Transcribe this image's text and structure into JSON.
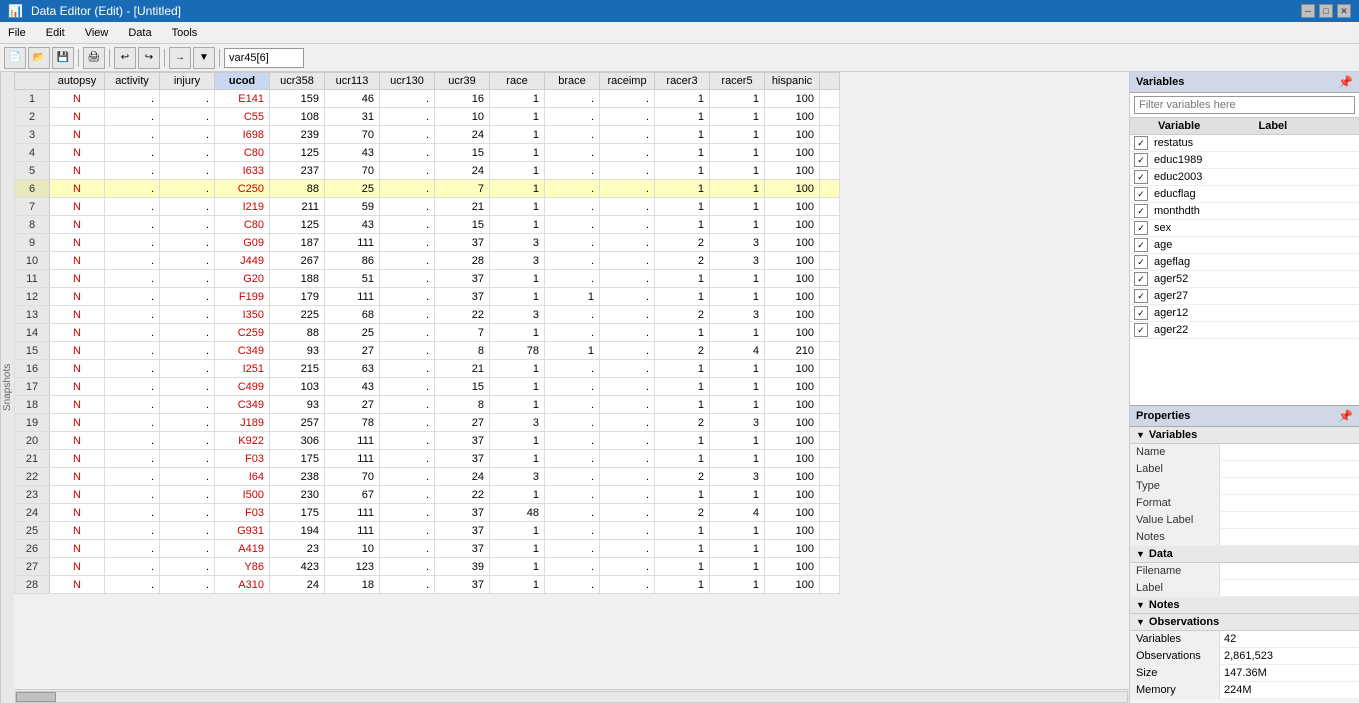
{
  "titlebar": {
    "title": "Data Editor (Edit) - [Untitled]",
    "controls": [
      "minimize",
      "maximize",
      "close"
    ]
  },
  "menu": {
    "items": [
      "File",
      "Edit",
      "View",
      "Data",
      "Tools"
    ]
  },
  "toolbar": {
    "cell_ref": "var45[6]"
  },
  "columns": [
    {
      "id": "rownum",
      "label": ""
    },
    {
      "id": "autopsy",
      "label": "autopsy"
    },
    {
      "id": "activity",
      "label": "activity"
    },
    {
      "id": "injury",
      "label": "injury"
    },
    {
      "id": "ucod",
      "label": "ucod",
      "highlighted": true
    },
    {
      "id": "ucr358",
      "label": "ucr358"
    },
    {
      "id": "ucr113",
      "label": "ucr113"
    },
    {
      "id": "ucr130",
      "label": "ucr130"
    },
    {
      "id": "ucr39",
      "label": "ucr39"
    },
    {
      "id": "race",
      "label": "race"
    },
    {
      "id": "brace",
      "label": "brace"
    },
    {
      "id": "raceimp",
      "label": "raceimp"
    },
    {
      "id": "racer3",
      "label": "racer3"
    },
    {
      "id": "racer5",
      "label": "racer5"
    },
    {
      "id": "hispanic",
      "label": "hispanic"
    }
  ],
  "rows": [
    {
      "rownum": 1,
      "autopsy": "N",
      "activity": ".",
      "injury": ".",
      "ucod": "E141",
      "ucr358": 159,
      "ucr113": 46,
      "ucr130": ".",
      "ucr39": 16,
      "race": 1,
      "brace": ".",
      "raceimp": ".",
      "racer3": 1,
      "racer5": 1,
      "hispanic": 100
    },
    {
      "rownum": 2,
      "autopsy": "N",
      "activity": ".",
      "injury": ".",
      "ucod": "C55",
      "ucr358": 108,
      "ucr113": 31,
      "ucr130": ".",
      "ucr39": 10,
      "race": 1,
      "brace": ".",
      "raceimp": ".",
      "racer3": 1,
      "racer5": 1,
      "hispanic": 100
    },
    {
      "rownum": 3,
      "autopsy": "N",
      "activity": ".",
      "injury": ".",
      "ucod": "I698",
      "ucr358": 239,
      "ucr113": 70,
      "ucr130": ".",
      "ucr39": 24,
      "race": 1,
      "brace": ".",
      "raceimp": ".",
      "racer3": 1,
      "racer5": 1,
      "hispanic": 100
    },
    {
      "rownum": 4,
      "autopsy": "N",
      "activity": ".",
      "injury": ".",
      "ucod": "C80",
      "ucr358": 125,
      "ucr113": 43,
      "ucr130": ".",
      "ucr39": 15,
      "race": 1,
      "brace": ".",
      "raceimp": ".",
      "racer3": 1,
      "racer5": 1,
      "hispanic": 100
    },
    {
      "rownum": 5,
      "autopsy": "N",
      "activity": ".",
      "injury": ".",
      "ucod": "I633",
      "ucr358": 237,
      "ucr113": 70,
      "ucr130": ".",
      "ucr39": 24,
      "race": 1,
      "brace": ".",
      "raceimp": ".",
      "racer3": 1,
      "racer5": 1,
      "hispanic": 100
    },
    {
      "rownum": 6,
      "autopsy": "N",
      "activity": ".",
      "injury": ".",
      "ucod": "C250",
      "ucr358": 88,
      "ucr113": 25,
      "ucr130": ".",
      "ucr39": 7,
      "race": 1,
      "brace": ".",
      "raceimp": ".",
      "racer3": 1,
      "racer5": 1,
      "hispanic": 100,
      "selected": true
    },
    {
      "rownum": 7,
      "autopsy": "N",
      "activity": ".",
      "injury": ".",
      "ucod": "I219",
      "ucr358": 211,
      "ucr113": 59,
      "ucr130": ".",
      "ucr39": 21,
      "race": 1,
      "brace": ".",
      "raceimp": ".",
      "racer3": 1,
      "racer5": 1,
      "hispanic": 100
    },
    {
      "rownum": 8,
      "autopsy": "N",
      "activity": ".",
      "injury": ".",
      "ucod": "C80",
      "ucr358": 125,
      "ucr113": 43,
      "ucr130": ".",
      "ucr39": 15,
      "race": 1,
      "brace": ".",
      "raceimp": ".",
      "racer3": 1,
      "racer5": 1,
      "hispanic": 100
    },
    {
      "rownum": 9,
      "autopsy": "N",
      "activity": ".",
      "injury": ".",
      "ucod": "G09",
      "ucr358": 187,
      "ucr113": 111,
      "ucr130": ".",
      "ucr39": 37,
      "race": 3,
      "brace": ".",
      "raceimp": ".",
      "racer3": 2,
      "racer5": 3,
      "hispanic": 100
    },
    {
      "rownum": 10,
      "autopsy": "N",
      "activity": ".",
      "injury": ".",
      "ucod": "J449",
      "ucr358": 267,
      "ucr113": 86,
      "ucr130": ".",
      "ucr39": 28,
      "race": 3,
      "brace": ".",
      "raceimp": ".",
      "racer3": 2,
      "racer5": 3,
      "hispanic": 100
    },
    {
      "rownum": 11,
      "autopsy": "N",
      "activity": ".",
      "injury": ".",
      "ucod": "G20",
      "ucr358": 188,
      "ucr113": 51,
      "ucr130": ".",
      "ucr39": 37,
      "race": 1,
      "brace": ".",
      "raceimp": ".",
      "racer3": 1,
      "racer5": 1,
      "hispanic": 100
    },
    {
      "rownum": 12,
      "autopsy": "N",
      "activity": ".",
      "injury": ".",
      "ucod": "F199",
      "ucr358": 179,
      "ucr113": 111,
      "ucr130": ".",
      "ucr39": 37,
      "race": 1,
      "brace": 1,
      "raceimp": ".",
      "racer3": 1,
      "racer5": 1,
      "hispanic": 100
    },
    {
      "rownum": 13,
      "autopsy": "N",
      "activity": ".",
      "injury": ".",
      "ucod": "I350",
      "ucr358": 225,
      "ucr113": 68,
      "ucr130": ".",
      "ucr39": 22,
      "race": 3,
      "brace": ".",
      "raceimp": ".",
      "racer3": 2,
      "racer5": 3,
      "hispanic": 100
    },
    {
      "rownum": 14,
      "autopsy": "N",
      "activity": ".",
      "injury": ".",
      "ucod": "C259",
      "ucr358": 88,
      "ucr113": 25,
      "ucr130": ".",
      "ucr39": 7,
      "race": 1,
      "brace": ".",
      "raceimp": ".",
      "racer3": 1,
      "racer5": 1,
      "hispanic": 100
    },
    {
      "rownum": 15,
      "autopsy": "N",
      "activity": ".",
      "injury": ".",
      "ucod": "C349",
      "ucr358": 93,
      "ucr113": 27,
      "ucr130": ".",
      "ucr39": 8,
      "race": 78,
      "brace": 1,
      "raceimp": ".",
      "racer3": 2,
      "racer5": 4,
      "hispanic": 210
    },
    {
      "rownum": 16,
      "autopsy": "N",
      "activity": ".",
      "injury": ".",
      "ucod": "I251",
      "ucr358": 215,
      "ucr113": 63,
      "ucr130": ".",
      "ucr39": 21,
      "race": 1,
      "brace": ".",
      "raceimp": ".",
      "racer3": 1,
      "racer5": 1,
      "hispanic": 100
    },
    {
      "rownum": 17,
      "autopsy": "N",
      "activity": ".",
      "injury": ".",
      "ucod": "C499",
      "ucr358": 103,
      "ucr113": 43,
      "ucr130": ".",
      "ucr39": 15,
      "race": 1,
      "brace": ".",
      "raceimp": ".",
      "racer3": 1,
      "racer5": 1,
      "hispanic": 100
    },
    {
      "rownum": 18,
      "autopsy": "N",
      "activity": ".",
      "injury": ".",
      "ucod": "C349",
      "ucr358": 93,
      "ucr113": 27,
      "ucr130": ".",
      "ucr39": 8,
      "race": 1,
      "brace": ".",
      "raceimp": ".",
      "racer3": 1,
      "racer5": 1,
      "hispanic": 100
    },
    {
      "rownum": 19,
      "autopsy": "N",
      "activity": ".",
      "injury": ".",
      "ucod": "J189",
      "ucr358": 257,
      "ucr113": 78,
      "ucr130": ".",
      "ucr39": 27,
      "race": 3,
      "brace": ".",
      "raceimp": ".",
      "racer3": 2,
      "racer5": 3,
      "hispanic": 100
    },
    {
      "rownum": 20,
      "autopsy": "N",
      "activity": ".",
      "injury": ".",
      "ucod": "K922",
      "ucr358": 306,
      "ucr113": 111,
      "ucr130": ".",
      "ucr39": 37,
      "race": 1,
      "brace": ".",
      "raceimp": ".",
      "racer3": 1,
      "racer5": 1,
      "hispanic": 100
    },
    {
      "rownum": 21,
      "autopsy": "N",
      "activity": ".",
      "injury": ".",
      "ucod": "F03",
      "ucr358": 175,
      "ucr113": 111,
      "ucr130": ".",
      "ucr39": 37,
      "race": 1,
      "brace": ".",
      "raceimp": ".",
      "racer3": 1,
      "racer5": 1,
      "hispanic": 100
    },
    {
      "rownum": 22,
      "autopsy": "N",
      "activity": ".",
      "injury": ".",
      "ucod": "I64",
      "ucr358": 238,
      "ucr113": 70,
      "ucr130": ".",
      "ucr39": 24,
      "race": 3,
      "brace": ".",
      "raceimp": ".",
      "racer3": 2,
      "racer5": 3,
      "hispanic": 100
    },
    {
      "rownum": 23,
      "autopsy": "N",
      "activity": ".",
      "injury": ".",
      "ucod": "I500",
      "ucr358": 230,
      "ucr113": 67,
      "ucr130": ".",
      "ucr39": 22,
      "race": 1,
      "brace": ".",
      "raceimp": ".",
      "racer3": 1,
      "racer5": 1,
      "hispanic": 100
    },
    {
      "rownum": 24,
      "autopsy": "N",
      "activity": ".",
      "injury": ".",
      "ucod": "F03",
      "ucr358": 175,
      "ucr113": 111,
      "ucr130": ".",
      "ucr39": 37,
      "race": 48,
      "brace": ".",
      "raceimp": ".",
      "racer3": 2,
      "racer5": 4,
      "hispanic": 100
    },
    {
      "rownum": 25,
      "autopsy": "N",
      "activity": ".",
      "injury": ".",
      "ucod": "G931",
      "ucr358": 194,
      "ucr113": 111,
      "ucr130": ".",
      "ucr39": 37,
      "race": 1,
      "brace": ".",
      "raceimp": ".",
      "racer3": 1,
      "racer5": 1,
      "hispanic": 100
    },
    {
      "rownum": 26,
      "autopsy": "N",
      "activity": ".",
      "injury": ".",
      "ucod": "A419",
      "ucr358": 23,
      "ucr113": 10,
      "ucr130": ".",
      "ucr39": 37,
      "race": 1,
      "brace": ".",
      "raceimp": ".",
      "racer3": 1,
      "racer5": 1,
      "hispanic": 100
    },
    {
      "rownum": 27,
      "autopsy": "N",
      "activity": ".",
      "injury": ".",
      "ucod": "Y86",
      "ucr358": 423,
      "ucr113": 123,
      "ucr130": ".",
      "ucr39": 39,
      "race": 1,
      "brace": ".",
      "raceimp": ".",
      "racer3": 1,
      "racer5": 1,
      "hispanic": 100
    },
    {
      "rownum": 28,
      "autopsy": "N",
      "activity": ".",
      "injury": ".",
      "ucod": "A310",
      "ucr358": 24,
      "ucr113": 18,
      "ucr130": ".",
      "ucr39": 37,
      "race": 1,
      "brace": ".",
      "raceimp": ".",
      "racer3": 1,
      "racer5": 1,
      "hispanic": 100
    }
  ],
  "right_panel": {
    "variables_title": "Variables",
    "filter_placeholder": "Filter variables here",
    "col_variable": "Variable",
    "col_label": "Label",
    "variables": [
      {
        "name": "restatus",
        "label": "",
        "checked": true
      },
      {
        "name": "educ1989",
        "label": "",
        "checked": true
      },
      {
        "name": "educ2003",
        "label": "",
        "checked": true
      },
      {
        "name": "educflag",
        "label": "",
        "checked": true
      },
      {
        "name": "monthdth",
        "label": "",
        "checked": true
      },
      {
        "name": "sex",
        "label": "",
        "checked": true
      },
      {
        "name": "age",
        "label": "",
        "checked": true
      },
      {
        "name": "ageflag",
        "label": "",
        "checked": true
      },
      {
        "name": "ager52",
        "label": "",
        "checked": true
      },
      {
        "name": "ager27",
        "label": "",
        "checked": true
      },
      {
        "name": "ager12",
        "label": "",
        "checked": true
      },
      {
        "name": "ager22",
        "label": "",
        "checked": true
      }
    ]
  },
  "properties": {
    "title": "Properties",
    "variables_group": "Variables",
    "fields": [
      {
        "key": "Name",
        "value": ""
      },
      {
        "key": "Label",
        "value": ""
      },
      {
        "key": "Type",
        "value": ""
      },
      {
        "key": "Format",
        "value": ""
      },
      {
        "key": "Value Label",
        "value": ""
      },
      {
        "key": "Notes",
        "value": ""
      }
    ],
    "data_group": "Data",
    "data_fields": [
      {
        "key": "Filename",
        "value": ""
      },
      {
        "key": "Label",
        "value": ""
      }
    ],
    "notes_group": "Notes",
    "observations_group": "Observations",
    "obs_fields": [
      {
        "key": "Variables",
        "value": "42"
      },
      {
        "key": "Observations",
        "value": "2,861,523"
      },
      {
        "key": "Size",
        "value": "147.36M"
      },
      {
        "key": "Memory",
        "value": "224M"
      }
    ]
  },
  "statusbar": {
    "row_label": "Snapshots"
  }
}
